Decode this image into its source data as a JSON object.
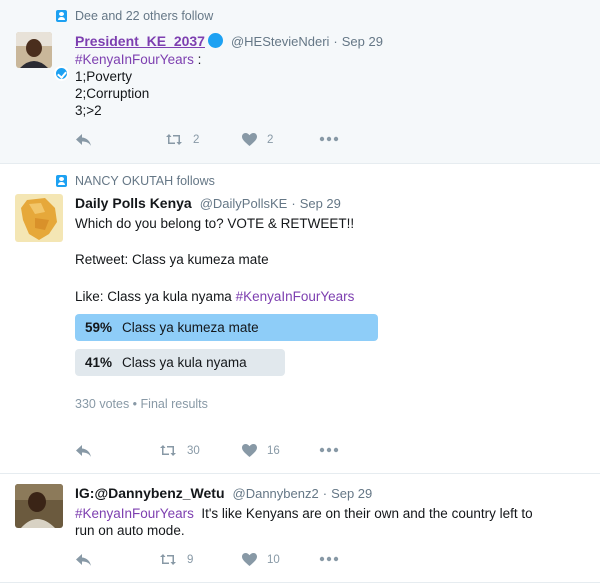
{
  "tweets": [
    {
      "context": "Dee and 22 others follow",
      "fullname": "President_KE_2037",
      "handle": "@HEStevieNderi",
      "separator": "·",
      "time": "Sep 29",
      "hashtag": "#KenyaInFourYears",
      "hashtag_suffix": " :",
      "lines": [
        "1;Poverty",
        "2;Corruption",
        "3;>2"
      ],
      "retweets": "2",
      "likes": "2"
    },
    {
      "context": "NANCY OKUTAH follows",
      "fullname": "Daily Polls Kenya",
      "handle": "@DailyPollsKE",
      "separator": "·",
      "time": "Sep 29",
      "line1": "Which do you belong to? VOTE & RETWEET!!",
      "line2": "Retweet: Class ya kumeza mate",
      "line3_prefix": "Like: Class ya kula nyama ",
      "hashtag": "#KenyaInFourYears",
      "poll": [
        {
          "percent": "59%",
          "label": "Class ya kumeza mate",
          "fraction": 0.59
        },
        {
          "percent": "41%",
          "label": "Class ya kula nyama",
          "fraction": 0.41
        }
      ],
      "poll_meta": "330 votes • Final results",
      "retweets": "30",
      "likes": "16"
    },
    {
      "fullname": "IG:@Dannybenz_Wetu",
      "handle": "@Dannybenz2",
      "separator": "·",
      "time": "Sep 29",
      "hashtag": "#KenyaInFourYears",
      "text_line1": "  It's like Kenyans are on their own and the country left to",
      "text_line2": "run on auto mode.",
      "retweets": "9",
      "likes": "10"
    }
  ],
  "colors": {
    "accent": "#1da1f2",
    "hashtag": "#7d3fb0",
    "poll_winner": "#8ecdf8",
    "poll_loser": "#e1e8ed",
    "muted": "#657786"
  }
}
